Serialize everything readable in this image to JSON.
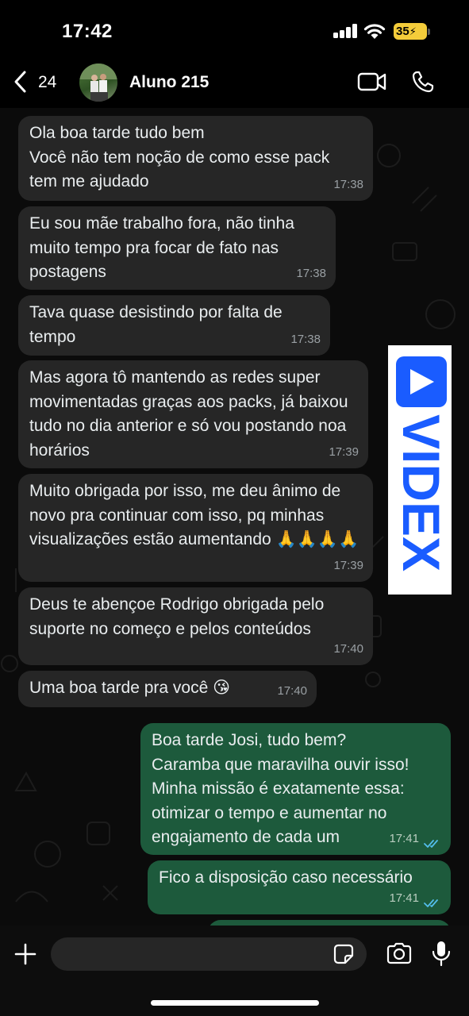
{
  "status_bar": {
    "time": "17:42",
    "battery": "35"
  },
  "header": {
    "back_count": "24",
    "contact_name": "Aluno 215"
  },
  "messages": [
    {
      "text": "Ola boa tarde tudo bem\nVocê não tem noção de como esse pack tem me ajudado",
      "time": "17:38"
    },
    {
      "text": "Eu sou mãe trabalho fora, não tinha muito tempo pra focar de fato nas postagens",
      "time": "17:38"
    },
    {
      "text": "Tava quase desistindo por falta de tempo",
      "time": "17:38"
    },
    {
      "text": "Mas agora tô mantendo as redes super movimentadas graças aos packs, já baixou tudo no dia anterior e só vou postando noa horários",
      "time": "17:39"
    },
    {
      "text": "Muito obrigada por isso, me deu ânimo de novo pra continuar com isso, pq minhas visualizações estão aumentando 🙏🙏🙏🙏",
      "time": "17:39"
    },
    {
      "text": "Deus te abençoe Rodrigo obrigada pelo suporte no começo e pelos conteúdos",
      "time": "17:40"
    },
    {
      "text": "Uma boa tarde pra você 😘",
      "time": "17:40"
    },
    {
      "text": "Boa tarde Josi, tudo bem?\nCaramba que maravilha ouvir isso!\nMinha missão é exatamente essa: otimizar o tempo e aumentar no engajamento de cada um",
      "time": "17:41"
    },
    {
      "text": "Fico a disposição caso necessário",
      "time": "17:41"
    }
  ],
  "watermark": {
    "text": "VIDEX",
    "color": "#1a5cff"
  },
  "colors": {
    "incoming_bubble": "#262626",
    "outgoing_bubble": "#1d5a3c",
    "read_ticks": "#53bdeb"
  }
}
